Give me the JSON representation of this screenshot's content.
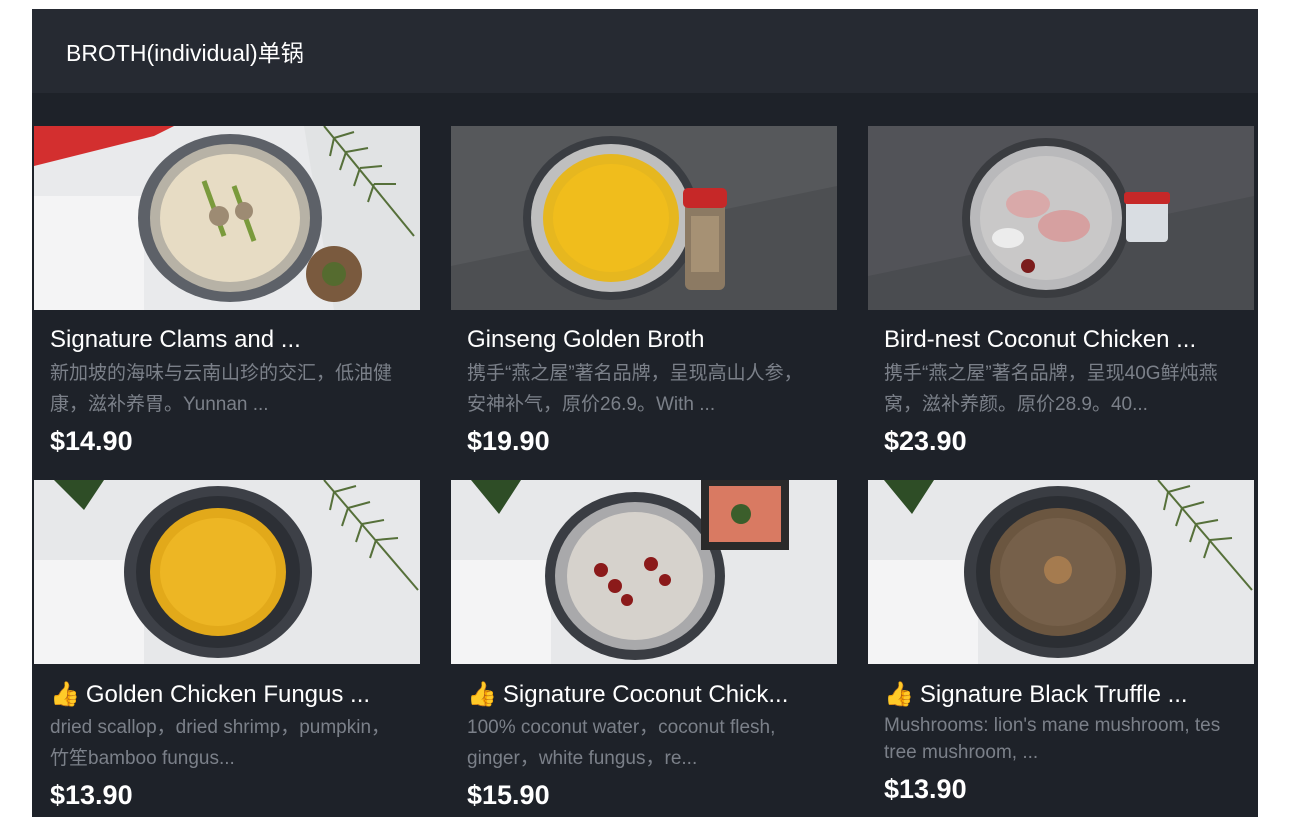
{
  "section": {
    "title": "BROTH(individual)单锅"
  },
  "colors": {
    "screen_bg": "#1e2229",
    "header_bg": "#262a32",
    "desc_text": "#7b8089",
    "badge_red": "#d32f2f"
  },
  "items": [
    {
      "title": "Signature Clams and ...",
      "description": "新加坡的海味与云南山珍的交汇，低油健康，滋补养胃。Yunnan ...",
      "price": "$14.90",
      "icon": "",
      "image": "clam-broth-pot"
    },
    {
      "title": "Ginseng Golden Broth",
      "description": "携手“燕之屋”著名品牌，呈现高山人参，安神补气，原价26.9。With ...",
      "price": "$19.90",
      "icon": "",
      "image": "ginseng-broth-pot"
    },
    {
      "title": "Bird-nest Coconut Chicken ...",
      "description": "携手“燕之屋”著名品牌，呈现40G鲜炖燕窝，滋补养颜。原价28.9。40...",
      "price": "$23.90",
      "icon": "",
      "image": "birdnest-broth-pot"
    },
    {
      "title": "Golden Chicken Fungus ...",
      "description": "dried scallop，dried shrimp，pumpkin，竹笙bamboo fungus...",
      "price": "$13.90",
      "icon": "thumbs-up-icon",
      "image": "golden-chicken-pot"
    },
    {
      "title": "Signature Coconut Chick...",
      "description": "100% coconut water，coconut flesh, ginger，white fungus，re...",
      "price": "$15.90",
      "icon": "thumbs-up-icon",
      "image": "coconut-chicken-pot"
    },
    {
      "title": "Signature Black Truffle ...",
      "description": "Mushrooms: lion's mane mushroom, tes tree mushroom, ...",
      "price": "$13.90",
      "icon": "thumbs-up-icon",
      "image": "black-truffle-pot"
    }
  ]
}
